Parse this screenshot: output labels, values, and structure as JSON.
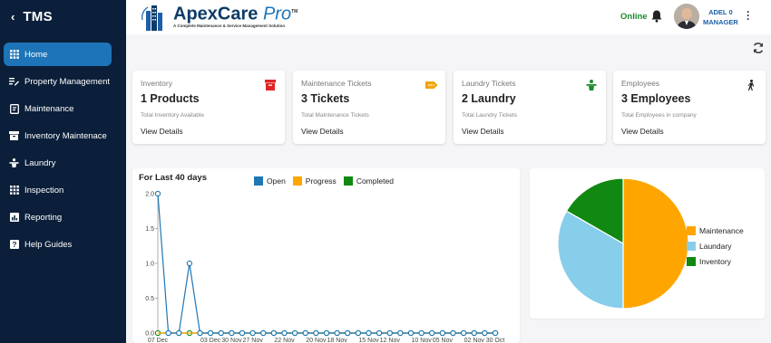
{
  "sidebar": {
    "back_glyph": "‹",
    "app_name": "TMS",
    "items": [
      {
        "label": "Home",
        "icon": "grid-icon",
        "active": true
      },
      {
        "label": "Property Management",
        "icon": "edit-list-icon"
      },
      {
        "label": "Maintenance",
        "icon": "document-tool-icon"
      },
      {
        "label": "Inventory Maintenace",
        "icon": "archive-box-icon"
      },
      {
        "label": "Laundry",
        "icon": "laundry-person-icon"
      },
      {
        "label": "Inspection",
        "icon": "grid-icon"
      },
      {
        "label": "Reporting",
        "icon": "bar-report-icon"
      },
      {
        "label": "Help Guides",
        "icon": "help-icon"
      }
    ]
  },
  "header": {
    "logo_title": "ApexCare",
    "logo_pro": "Pro",
    "logo_tm": "TM",
    "logo_subtitle": "A Complete Maintenance & Service Management Solution",
    "status": "Online",
    "user_name": "ADEL 0",
    "user_role": "MANAGER"
  },
  "cards": [
    {
      "title": "Inventory",
      "value": "1 Products",
      "sub": "Total Inventory Available",
      "link": "View Details",
      "icon": "archive-box-icon",
      "icon_color": "#e02424"
    },
    {
      "title": "Maintenance Tickets",
      "value": "3 Tickets",
      "sub": "Total Maintenance Tickets",
      "link": "View Details",
      "icon": "tag-icon",
      "icon_color": "#f4a300"
    },
    {
      "title": "Laundry Tickets",
      "value": "2 Laundry",
      "sub": "Total Laundry Tickets",
      "link": "View Details",
      "icon": "laundry-person-icon",
      "icon_color": "#1b8a2a"
    },
    {
      "title": "Employees",
      "value": "3 Employees",
      "sub": "Total Employees in company",
      "link": "View Details",
      "icon": "person-walking-icon",
      "icon_color": "#222222"
    }
  ],
  "line_chart_title": "For Last 40 days",
  "pie_chart_title": "",
  "colors": {
    "open": "#1f77b4",
    "progress": "#ffa500",
    "completed": "#118811",
    "maintenance": "#ffa500",
    "laundary": "#87ceeb",
    "inventory": "#118811",
    "sidebar_bg": "#0b1f3a",
    "active": "#1d74b8"
  },
  "chart_data": [
    {
      "type": "line",
      "title": "For Last 40 days",
      "ylim": [
        0,
        2.0
      ],
      "yticks": [
        "0.0",
        "0.5",
        "1.0",
        "1.5",
        "2.0"
      ],
      "x": [
        "07 Dec",
        "",
        "",
        "",
        "",
        "03 Dec",
        "",
        "30 Nov",
        "",
        "27 Nov",
        "",
        "",
        "22 Nov",
        "",
        "",
        "20 Nov",
        "",
        "18 Nov",
        "",
        "",
        "15 Nov",
        "",
        "12 Nov",
        "",
        "",
        "10 Nov",
        "",
        "05 Nov",
        "",
        "",
        "02 Nov",
        "",
        "30 Oct"
      ],
      "xtick_labels": [
        "07 Dec",
        "03 Dec",
        "30 Nov",
        "27 Nov",
        "22 Nov",
        "20 Nov",
        "18 Nov",
        "15 Nov",
        "12 Nov",
        "10 Nov",
        "05 Nov",
        "02 Nov",
        "30 Oct"
      ],
      "series": [
        {
          "name": "Open",
          "values": [
            2,
            0,
            0,
            1,
            0,
            0,
            0,
            0,
            0,
            0,
            0,
            0,
            0,
            0,
            0,
            0,
            0,
            0,
            0,
            0,
            0,
            0,
            0,
            0,
            0,
            0,
            0,
            0,
            0,
            0,
            0,
            0,
            0
          ]
        },
        {
          "name": "Progress",
          "values": [
            0,
            0,
            0,
            0,
            0,
            0,
            0,
            0,
            0,
            0,
            0,
            0,
            0,
            0,
            0,
            0,
            0,
            0,
            0,
            0,
            0,
            0,
            0,
            0,
            0,
            0,
            0,
            0,
            0,
            0,
            0,
            0,
            0
          ]
        },
        {
          "name": "Completed",
          "values": [
            0,
            0,
            0,
            0,
            0,
            0,
            0,
            0,
            0,
            0,
            0,
            0,
            0,
            0,
            0,
            0,
            0,
            0,
            0,
            0,
            0,
            0,
            0,
            0,
            0,
            0,
            0,
            0,
            0,
            0,
            0,
            0,
            0
          ]
        }
      ]
    },
    {
      "type": "pie",
      "categories": [
        "Maintenance",
        "Laundary",
        "Inventory"
      ],
      "values": [
        50,
        33.3,
        16.7
      ]
    }
  ]
}
